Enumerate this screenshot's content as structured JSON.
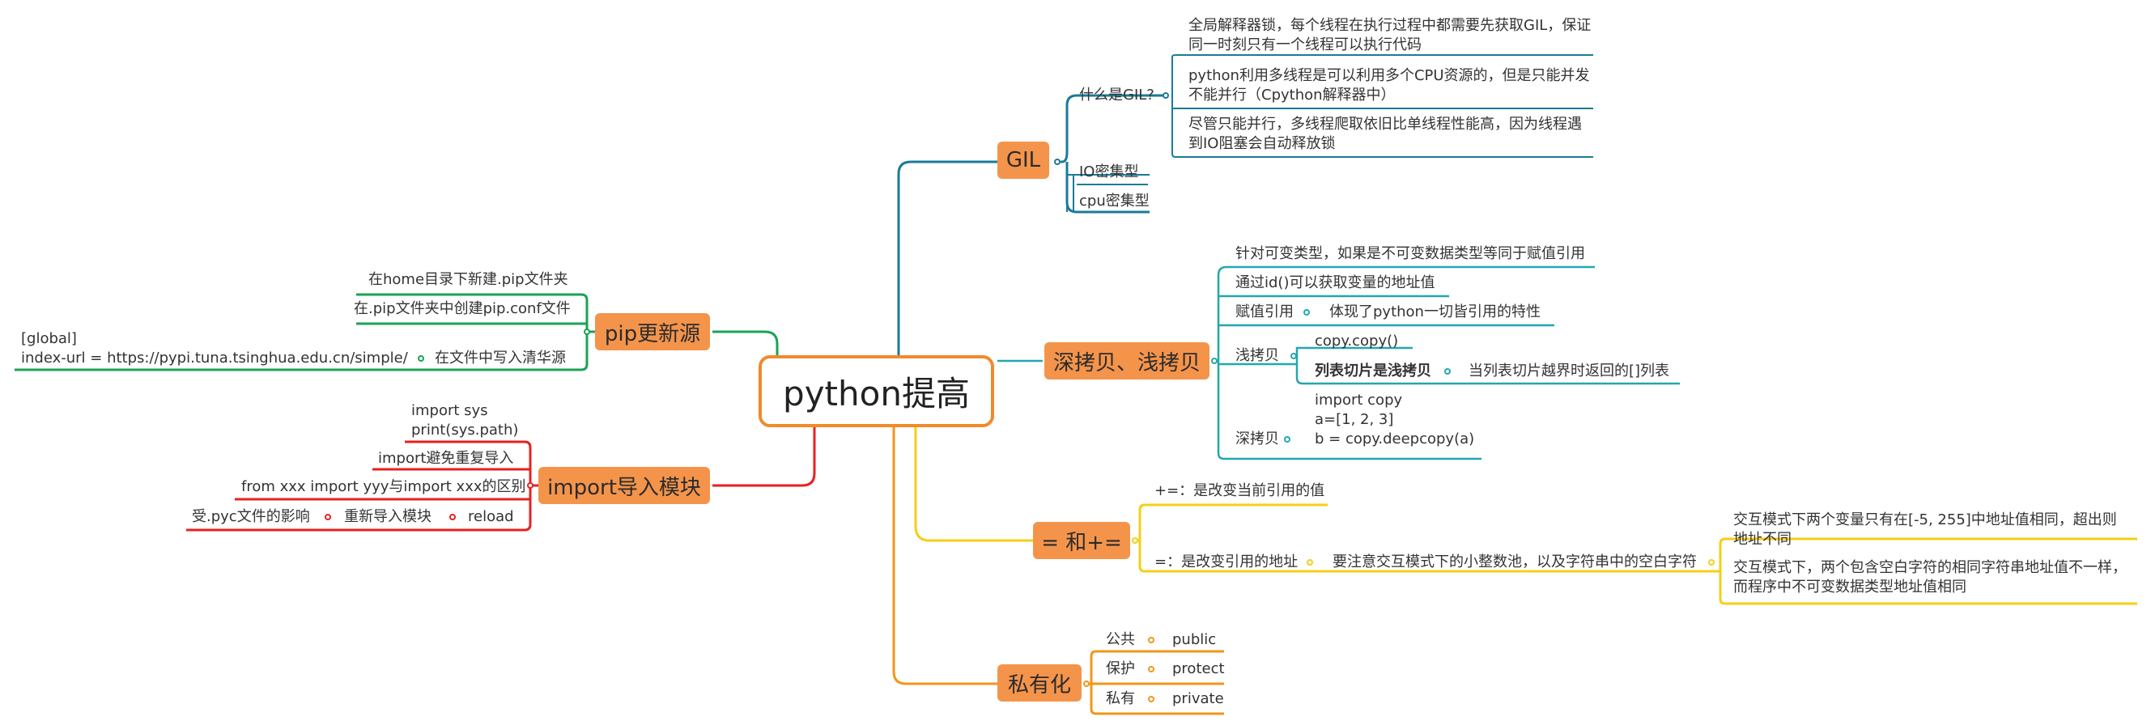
{
  "root": "python提高",
  "colors": {
    "gil": "#1a7a9a",
    "copy": "#22a7b0",
    "eq": "#f5cf16",
    "priv": "#f2961a",
    "pip": "#1aa354",
    "imp": "#e8201f",
    "node_fill": "#f4944b"
  },
  "gil": {
    "label": "GIL",
    "what": "什么是GIL?",
    "desc1": "全局解释器锁，每个线程在执行过程中都需要先获取GIL，保证同一时刻只有一个线程可以执行代码",
    "desc2": "python利用多线程是可以利用多个CPU资源的，但是只能并发不能并行（Cpython解释器中）",
    "desc3": "尽管只能并行，多线程爬取依旧比单线程性能高，因为线程遇到IO阻塞会自动释放锁",
    "io": "IO密集型",
    "cpu": "cpu密集型"
  },
  "copy": {
    "label": "深拷贝、浅拷贝",
    "c1": "针对可变类型，如果是不可变数据类型等同于赋值引用",
    "c2": "通过id()可以获取变量的地址值",
    "assign": "赋值引用",
    "assign_note": "体现了python一切皆引用的特性",
    "shallow": "浅拷贝",
    "shallow_a": "copy.copy()",
    "shallow_b": "列表切片是浅拷贝",
    "shallow_b_note": "当列表切片越界时返回的[]列表",
    "deep": "深拷贝",
    "deep_code1": "import copy",
    "deep_code2": "a=[1, 2, 3]",
    "deep_code3": "b = copy.deepcopy(a)"
  },
  "eq": {
    "label": "= 和+=",
    "plus": "+=：是改变当前引用的值",
    "assign": "=：是改变引用的地址",
    "note": "要注意交互模式下的小整数池，以及字符串中的空白字符",
    "n1": "交互模式下两个变量只有在[-5, 255]中地址值相同，超出则地址不同",
    "n2": "交互模式下，两个包含空白字符的相同字符串地址值不一样，而程序中不可变数据类型地址值相同"
  },
  "priv": {
    "label": "私有化",
    "items": [
      {
        "cn": "公共",
        "en": "public"
      },
      {
        "cn": "保护",
        "en": "protect"
      },
      {
        "cn": "私有",
        "en": "private"
      }
    ]
  },
  "pip": {
    "label": "pip更新源",
    "p1": "在home目录下新建.pip文件夹",
    "p2": "在.pip文件夹中创建pip.conf文件",
    "p3": "在文件中写入清华源",
    "cfg1": "[global]",
    "cfg2": "index-url = https://pypi.tuna.tsinghua.edu.cn/simple/"
  },
  "imp": {
    "label": "import导入模块",
    "code1": "import sys",
    "code2": "print(sys.path)",
    "i2": "import避免重复导入",
    "i3": "from xxx import yyy与import xxx的区别",
    "i4": "重新导入模块",
    "i4a": "reload",
    "i4b": "受.pyc文件的影响"
  }
}
